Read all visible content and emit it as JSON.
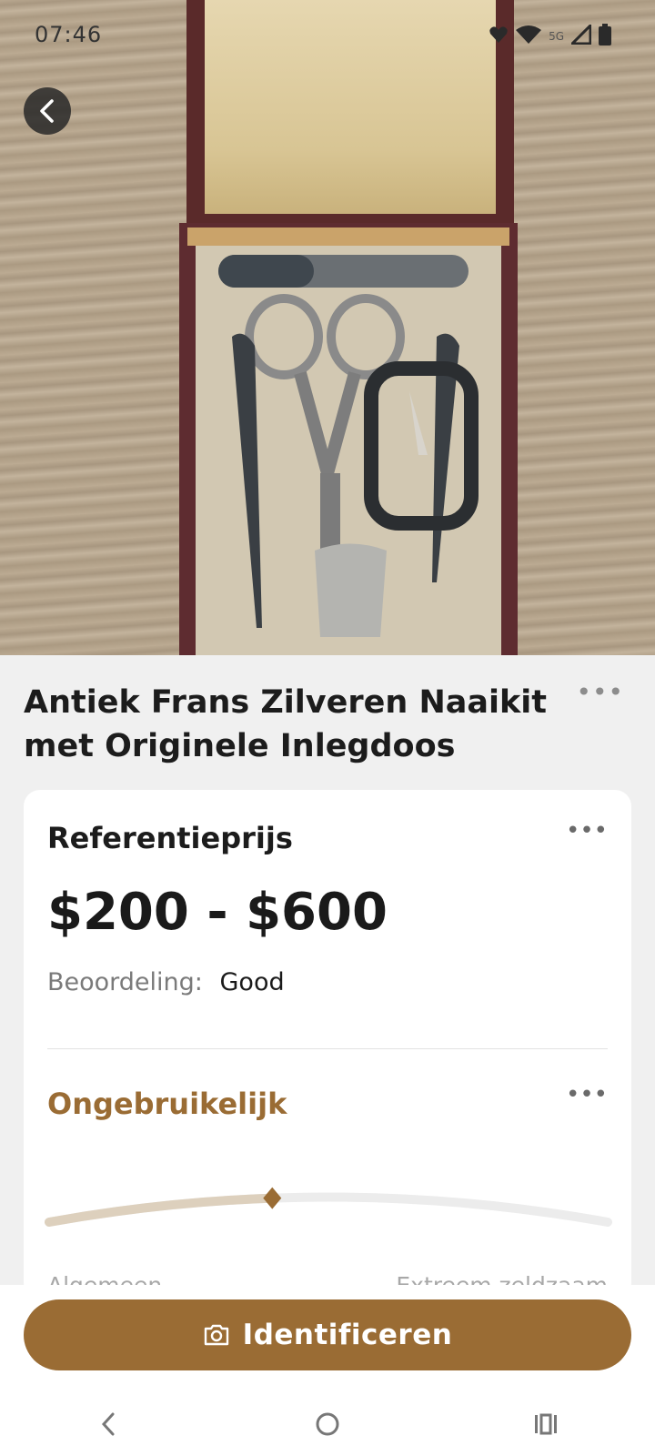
{
  "status_bar": {
    "time": "07:46",
    "network": "5G",
    "icons": [
      "heart-icon",
      "wifi-icon",
      "signal-icon",
      "battery-icon"
    ]
  },
  "product": {
    "title_line1": "Antiek Frans Zilveren Naaikit",
    "title_line2": "met Originele Inlegdoos"
  },
  "reference": {
    "label": "Referentieprijs",
    "price": "$200 - $600",
    "rating_label": "Beoordeling:",
    "rating_value": "Good"
  },
  "rarity": {
    "label": "Ongebruikelijk",
    "low_label": "Algemeen",
    "high_label": "Extreem zeldzaam",
    "level": 0.4
  },
  "action": {
    "identify_label": "Identificeren"
  },
  "colors": {
    "accent": "#9a6c34",
    "card_bg": "#ffffff",
    "page_bg": "#f0f0f0"
  }
}
